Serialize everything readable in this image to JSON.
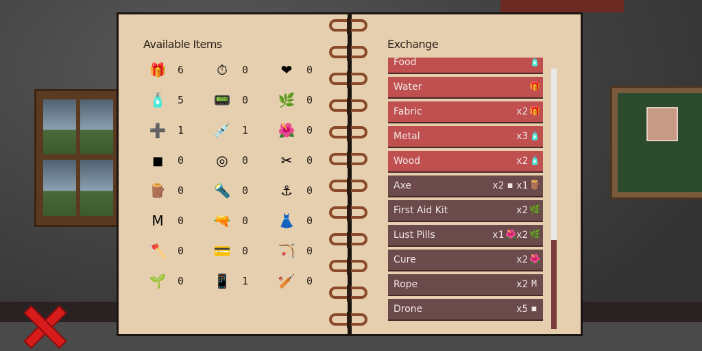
{
  "left_heading": "Available Items",
  "right_heading": "Exchange",
  "items": [
    {
      "icon": "fabric-icon",
      "glyph": "🎁",
      "count": "6"
    },
    {
      "icon": "clock-icon",
      "glyph": "⏱",
      "count": "0"
    },
    {
      "icon": "heart-icon",
      "glyph": "❤",
      "count": "0"
    },
    {
      "icon": "water-bottle-icon",
      "glyph": "🧴",
      "count": "5"
    },
    {
      "icon": "device-icon",
      "glyph": "📟",
      "count": "0"
    },
    {
      "icon": "green-herb-icon",
      "glyph": "🌿",
      "count": "0"
    },
    {
      "icon": "first-aid-kit-icon",
      "glyph": "➕",
      "count": "1"
    },
    {
      "icon": "syringe-icon",
      "glyph": "💉",
      "count": "1"
    },
    {
      "icon": "red-herb-icon",
      "glyph": "🌺",
      "count": "0"
    },
    {
      "icon": "metal-icon",
      "glyph": "◼",
      "count": "0"
    },
    {
      "icon": "tape-icon",
      "glyph": "◎",
      "count": "0"
    },
    {
      "icon": "pliers-icon",
      "glyph": "✂",
      "count": "0"
    },
    {
      "icon": "wood-log-icon",
      "glyph": "🪵",
      "count": "0"
    },
    {
      "icon": "flashlight-icon",
      "glyph": "🔦",
      "count": "0"
    },
    {
      "icon": "rope-pile-icon",
      "glyph": "⚓",
      "count": "0"
    },
    {
      "icon": "cloth-icon",
      "glyph": "M",
      "count": "0"
    },
    {
      "icon": "pistol-icon",
      "glyph": "🔫",
      "count": "0"
    },
    {
      "icon": "dress-icon",
      "glyph": "👗",
      "count": "0"
    },
    {
      "icon": "axe-icon",
      "glyph": "🪓",
      "count": "0"
    },
    {
      "icon": "card-icon",
      "glyph": "💳",
      "count": "0"
    },
    {
      "icon": "bow-icon",
      "glyph": "🏹",
      "count": "0"
    },
    {
      "icon": "plant-icon",
      "glyph": "🌱",
      "count": "0"
    },
    {
      "icon": "phone-icon",
      "glyph": "📱",
      "count": "1"
    },
    {
      "icon": "bat-icon",
      "glyph": "🏏",
      "count": "0"
    }
  ],
  "exchange": [
    {
      "name": "Food",
      "style": "red",
      "req": [
        {
          "qty": "",
          "icon": "water-bottle-icon",
          "glyph": "🧴"
        }
      ]
    },
    {
      "name": "Water",
      "style": "red",
      "req": [
        {
          "qty": "",
          "icon": "fabric-icon",
          "glyph": "🎁"
        }
      ]
    },
    {
      "name": "Fabric",
      "style": "red",
      "req": [
        {
          "qty": "x2",
          "icon": "fabric-icon",
          "glyph": "🎁"
        }
      ]
    },
    {
      "name": "Metal",
      "style": "red",
      "req": [
        {
          "qty": "x3",
          "icon": "water-bottle-icon",
          "glyph": "🧴"
        }
      ]
    },
    {
      "name": "Wood",
      "style": "red",
      "req": [
        {
          "qty": "x2",
          "icon": "water-bottle-icon",
          "glyph": "🧴"
        }
      ]
    },
    {
      "name": "Axe",
      "style": "dark",
      "req": [
        {
          "qty": "x2",
          "icon": "metal-icon",
          "glyph": "◼"
        },
        {
          "qty": "x1",
          "icon": "wood-log-icon",
          "glyph": "🪵"
        }
      ]
    },
    {
      "name": "First Aid Kit",
      "style": "dark",
      "req": [
        {
          "qty": "x2",
          "icon": "green-herb-icon",
          "glyph": "🌿"
        }
      ]
    },
    {
      "name": "Lust Pills",
      "style": "dark",
      "req": [
        {
          "qty": "x1",
          "icon": "red-herb-icon",
          "glyph": "🌺"
        },
        {
          "qty": "x2",
          "icon": "green-herb-icon",
          "glyph": "🌿"
        }
      ]
    },
    {
      "name": "Cure",
      "style": "dark",
      "req": [
        {
          "qty": "x2",
          "icon": "red-herb-icon",
          "glyph": "🌺"
        }
      ]
    },
    {
      "name": "Rope",
      "style": "dark",
      "req": [
        {
          "qty": "x2",
          "icon": "cloth-icon",
          "glyph": "M"
        }
      ]
    },
    {
      "name": "Drone",
      "style": "dark",
      "req": [
        {
          "qty": "x5",
          "icon": "metal-icon",
          "glyph": "◼"
        }
      ]
    }
  ]
}
